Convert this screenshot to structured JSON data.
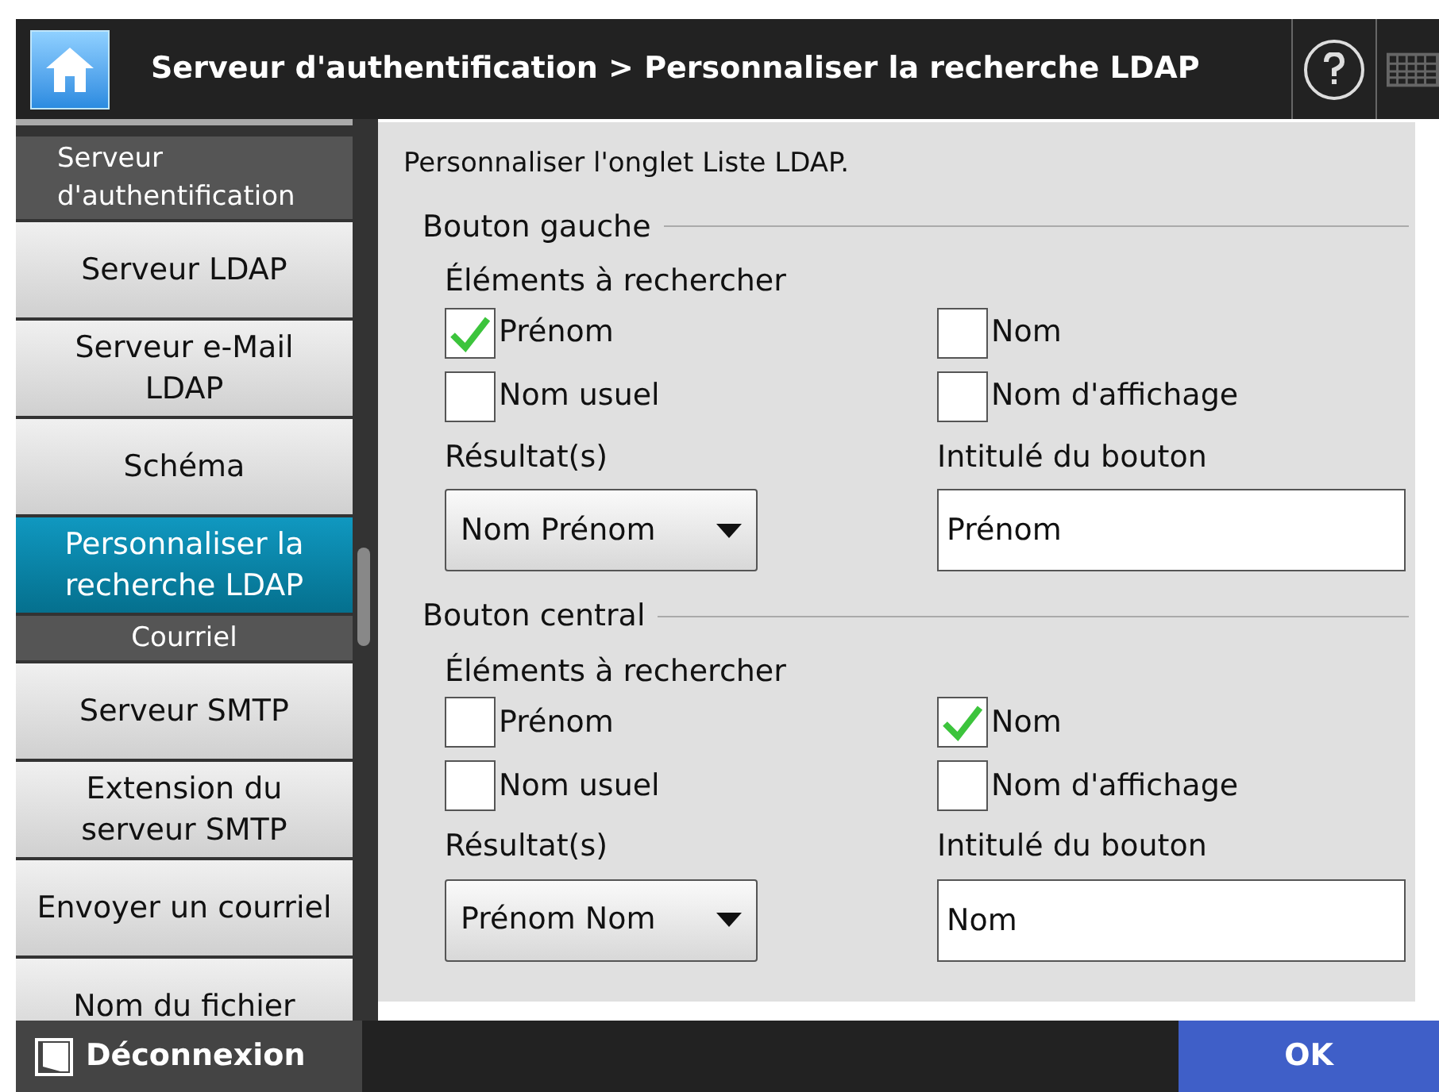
{
  "header": {
    "title": "Serveur d'authentification > Personnaliser la recherche LDAP"
  },
  "sidebar": {
    "items": [
      {
        "kind": "section",
        "label": "Serveur d'authentification",
        "selected": false
      },
      {
        "kind": "item",
        "label": "Serveur LDAP",
        "selected": false
      },
      {
        "kind": "item",
        "label": "Serveur e-Mail LDAP",
        "selected": false
      },
      {
        "kind": "item",
        "label": "Schéma",
        "selected": false
      },
      {
        "kind": "item",
        "label": "Personnaliser la recherche LDAP",
        "selected": true
      },
      {
        "kind": "section",
        "label": "Courriel",
        "selected": false
      },
      {
        "kind": "item",
        "label": "Serveur SMTP",
        "selected": false
      },
      {
        "kind": "item",
        "label": "Extension du serveur SMTP",
        "selected": false
      },
      {
        "kind": "item",
        "label": "Envoyer un courriel",
        "selected": false
      },
      {
        "kind": "item",
        "label": "Nom du fichier",
        "selected": false
      }
    ]
  },
  "content": {
    "intro": "Personnaliser l'onglet Liste LDAP.",
    "groups": [
      {
        "title": "Bouton gauche",
        "search_label": "Éléments à rechercher",
        "options": [
          {
            "label": "Prénom",
            "checked": true
          },
          {
            "label": "Nom",
            "checked": false
          },
          {
            "label": "Nom usuel",
            "checked": false
          },
          {
            "label": "Nom d'affichage",
            "checked": false
          }
        ],
        "result_label": "Résultat(s)",
        "result_value": "Nom Prénom",
        "caption_label": "Intitulé du bouton",
        "caption_value": "Prénom"
      },
      {
        "title": "Bouton central",
        "search_label": "Éléments à rechercher",
        "options": [
          {
            "label": "Prénom",
            "checked": false
          },
          {
            "label": "Nom",
            "checked": true
          },
          {
            "label": "Nom usuel",
            "checked": false
          },
          {
            "label": "Nom d'affichage",
            "checked": false
          }
        ],
        "result_label": "Résultat(s)",
        "result_value": "Prénom Nom",
        "caption_label": "Intitulé du bouton",
        "caption_value": "Nom"
      }
    ]
  },
  "footer": {
    "logout": "Déconnexion",
    "ok": "OK"
  }
}
